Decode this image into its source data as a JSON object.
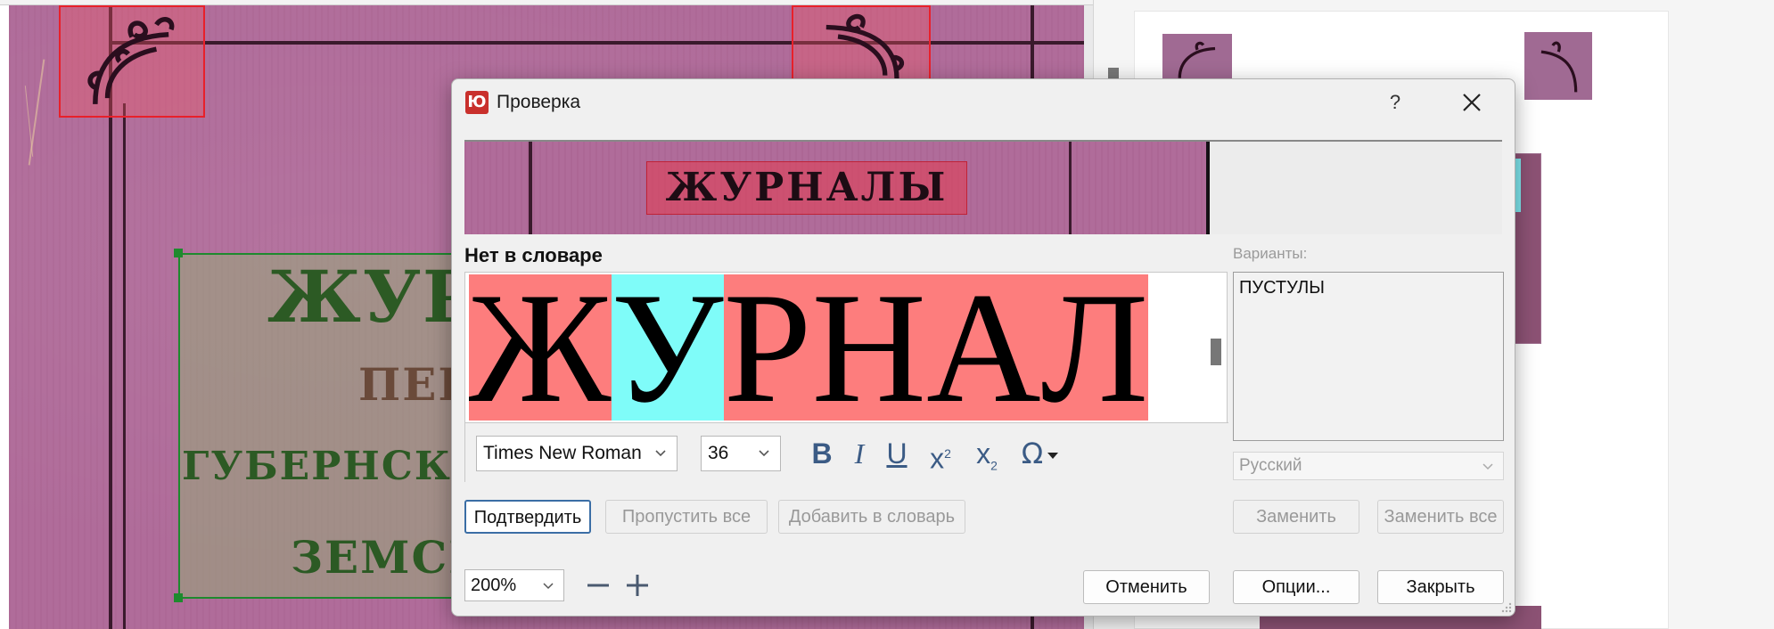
{
  "dialog": {
    "title": "Проверка",
    "app_icon": "finereader-icon",
    "help_label": "?",
    "preview_word": "ЖУРНАЛЫ",
    "not_in_dictionary_label": "Нет в словаре",
    "variants_label": "Варианты:",
    "word": {
      "letters": [
        "Ж",
        "У",
        "Р",
        "Н",
        "А",
        "Л"
      ],
      "highlighted_letter_index": 1,
      "error_color": "#fd7d7d",
      "highlight_color": "#7ffcf9"
    },
    "font_family": "Times New Roman",
    "font_size": "36",
    "format_buttons": {
      "bold": "B",
      "italic": "I",
      "underline": "U",
      "superscript": "x",
      "superscript_mark": "2",
      "subscript": "x",
      "subscript_mark": "2",
      "special_char": "Ω"
    },
    "variants": [
      "ПУСТУЛЫ"
    ],
    "language": "Русский",
    "buttons": {
      "confirm": "Подтвердить",
      "skip_all": "Пропустить все",
      "add_to_dictionary": "Добавить в словарь",
      "replace": "Заменить",
      "replace_all": "Заменить все",
      "cancel": "Отменить",
      "options": "Опции...",
      "close": "Закрыть"
    },
    "zoom": "200%"
  },
  "background": {
    "scan_lines": [
      "ЖУР",
      "ПЕР",
      "ГУБЕРНСКАГО",
      "ЗЕМСКАГ"
    ],
    "scan_color": "#b06c9a",
    "block_outline_color": "#1e8a2e",
    "picture_outline_color": "#e8202a"
  }
}
